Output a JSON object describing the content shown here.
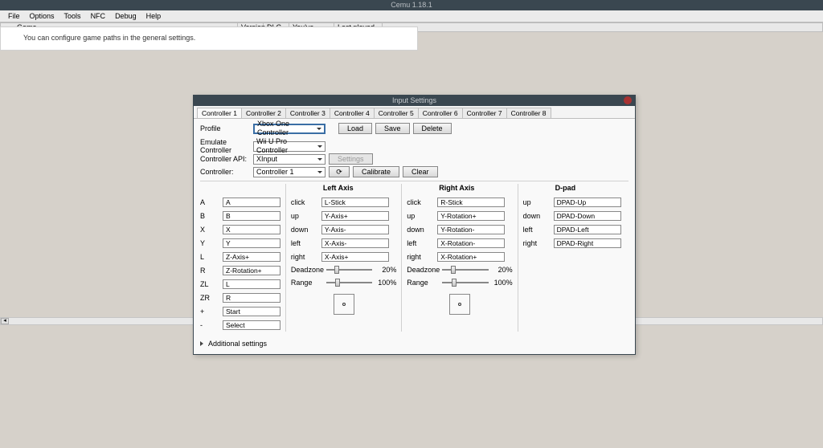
{
  "main_title": "Cemu 1.18.1",
  "menu": [
    "File",
    "Options",
    "Tools",
    "NFC",
    "Debug",
    "Help"
  ],
  "gamelist": {
    "cols": [
      "Game",
      "Version",
      "DLC",
      "You've played",
      "Last played"
    ]
  },
  "hint": "You can configure game paths in the general settings.",
  "dialog": {
    "title": "Input Settings",
    "tabs": [
      "Controller 1",
      "Controller 2",
      "Controller 3",
      "Controller 4",
      "Controller 5",
      "Controller 6",
      "Controller 7",
      "Controller 8"
    ],
    "profile": {
      "label": "Profile",
      "value": "Xbox One Controller",
      "load": "Load",
      "save": "Save",
      "delete": "Delete"
    },
    "emulate": {
      "label": "Emulate Controller",
      "value": "Wii U Pro Controller"
    },
    "api": {
      "label": "Controller API:",
      "value": "XInput",
      "settings": "Settings"
    },
    "controller": {
      "label": "Controller:",
      "value": "Controller 1",
      "calibrate": "Calibrate",
      "clear": "Clear"
    },
    "button_section": {
      "title": "",
      "rows": [
        {
          "l": "A",
          "v": "A"
        },
        {
          "l": "B",
          "v": "B"
        },
        {
          "l": "X",
          "v": "X"
        },
        {
          "l": "Y",
          "v": "Y"
        },
        {
          "l": "L",
          "v": "Z-Axis+"
        },
        {
          "l": "R",
          "v": "Z-Rotation+"
        },
        {
          "l": "ZL",
          "v": "L"
        },
        {
          "l": "ZR",
          "v": "R"
        },
        {
          "l": "+",
          "v": "Start"
        },
        {
          "l": "-",
          "v": "Select"
        }
      ]
    },
    "left_axis": {
      "title": "Left Axis",
      "rows": [
        {
          "l": "click",
          "v": "L-Stick"
        },
        {
          "l": "up",
          "v": "Y-Axis+"
        },
        {
          "l": "down",
          "v": "Y-Axis-"
        },
        {
          "l": "left",
          "v": "X-Axis-"
        },
        {
          "l": "right",
          "v": "X-Axis+"
        }
      ],
      "deadzone_label": "Deadzone",
      "deadzone": "20%",
      "range_label": "Range",
      "range": "100%"
    },
    "right_axis": {
      "title": "Right Axis",
      "rows": [
        {
          "l": "click",
          "v": "R-Stick"
        },
        {
          "l": "up",
          "v": "Y-Rotation+"
        },
        {
          "l": "down",
          "v": "Y-Rotation-"
        },
        {
          "l": "left",
          "v": "X-Rotation-"
        },
        {
          "l": "right",
          "v": "X-Rotation+"
        }
      ],
      "deadzone_label": "Deadzone",
      "deadzone": "20%",
      "range_label": "Range",
      "range": "100%"
    },
    "dpad": {
      "title": "D-pad",
      "rows": [
        {
          "l": "up",
          "v": "DPAD-Up"
        },
        {
          "l": "down",
          "v": "DPAD-Down"
        },
        {
          "l": "left",
          "v": "DPAD-Left"
        },
        {
          "l": "right",
          "v": "DPAD-Right"
        }
      ]
    },
    "additional": "Additional settings"
  }
}
